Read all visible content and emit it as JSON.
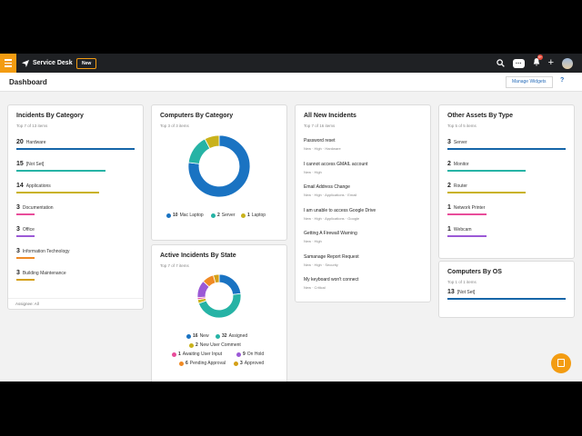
{
  "topbar": {
    "brand": "Service Desk",
    "new_button": "New",
    "notifications_badge": "9+"
  },
  "dashboard": {
    "title": "Dashboard",
    "manage_widgets": "Manage Widgets",
    "help": "?"
  },
  "incidents_by_category": {
    "title": "Incidents By Category",
    "subtitle": "Top 7 of 13 items",
    "footer": "Assignee: All",
    "items": [
      {
        "count": "20",
        "label": "Hardware",
        "color": "#1565a8",
        "fill": 1.0
      },
      {
        "count": "15",
        "label": "[Not Set]",
        "color": "#26b3a5",
        "fill": 0.75
      },
      {
        "count": "14",
        "label": "Applications",
        "color": "#c9b21c",
        "fill": 0.7
      },
      {
        "count": "3",
        "label": "Documentation",
        "color": "#e84c9a",
        "fill": 0.15
      },
      {
        "count": "3",
        "label": "Office",
        "color": "#9b59d6",
        "fill": 0.15
      },
      {
        "count": "3",
        "label": "Information Technology",
        "color": "#f08a24",
        "fill": 0.15
      },
      {
        "count": "3",
        "label": "Building Maintenance",
        "color": "#d4a017",
        "fill": 0.15
      }
    ]
  },
  "computers_by_category": {
    "title": "Computers By Category",
    "subtitle": "Top 3 of 3 items",
    "chart_data": {
      "type": "pie",
      "categories": [
        "Mac Laptop",
        "Server",
        "Laptop"
      ],
      "values": [
        10,
        2,
        1
      ],
      "colors": [
        "#1a73c2",
        "#26b3a5",
        "#c9b21c"
      ]
    }
  },
  "active_incidents_by_state": {
    "title": "Active Incidents By State",
    "subtitle": "Top 7 of 7 items",
    "chart_data": {
      "type": "pie",
      "categories": [
        "New",
        "Assigned",
        "New User Comment",
        "Awaiting User Input",
        "On Hold",
        "Pending Approval",
        "Approved"
      ],
      "values": [
        16,
        32,
        2,
        1,
        9,
        6,
        3
      ],
      "colors": [
        "#1a73c2",
        "#26b3a5",
        "#c9b21c",
        "#e84c9a",
        "#9b59d6",
        "#f08a24",
        "#d4a017"
      ]
    }
  },
  "all_new_incidents": {
    "title": "All New Incidents",
    "subtitle": "Top 7 of 16 items",
    "items": [
      {
        "title": "Password reset",
        "meta": "New  ·  High  ·  Hardware"
      },
      {
        "title": "I cannot access GMAIL account",
        "meta": "New  ·  High"
      },
      {
        "title": "Email Address Change",
        "meta": "New  ·  High  ·  Applications  ·  Email"
      },
      {
        "title": "I am unable to access Google Drive",
        "meta": "New  ·  High  ·  Applications  ·  Google"
      },
      {
        "title": "Getting A Firewall Warning",
        "meta": "New  ·  High"
      },
      {
        "title": "Samanage Report Request",
        "meta": "New  ·  High  ·  Security"
      },
      {
        "title": "My keyboard won't connect",
        "meta": "New  ·  Critical"
      }
    ]
  },
  "other_assets_by_type": {
    "title": "Other Assets By Type",
    "subtitle": "Top 5 of 5 items",
    "items": [
      {
        "count": "3",
        "label": "Server",
        "color": "#1565a8",
        "fill": 1.0
      },
      {
        "count": "2",
        "label": "Monitor",
        "color": "#26b3a5",
        "fill": 0.66
      },
      {
        "count": "2",
        "label": "Router",
        "color": "#c9b21c",
        "fill": 0.66
      },
      {
        "count": "1",
        "label": "Network Printer",
        "color": "#e84c9a",
        "fill": 0.33
      },
      {
        "count": "1",
        "label": "Webcam",
        "color": "#9b59d6",
        "fill": 0.33
      }
    ]
  },
  "computers_by_os": {
    "title": "Computers By OS",
    "subtitle": "Top 1 of 1 items",
    "items": [
      {
        "count": "13",
        "label": "[Not Set]",
        "color": "#1565a8",
        "fill": 1.0
      }
    ]
  }
}
